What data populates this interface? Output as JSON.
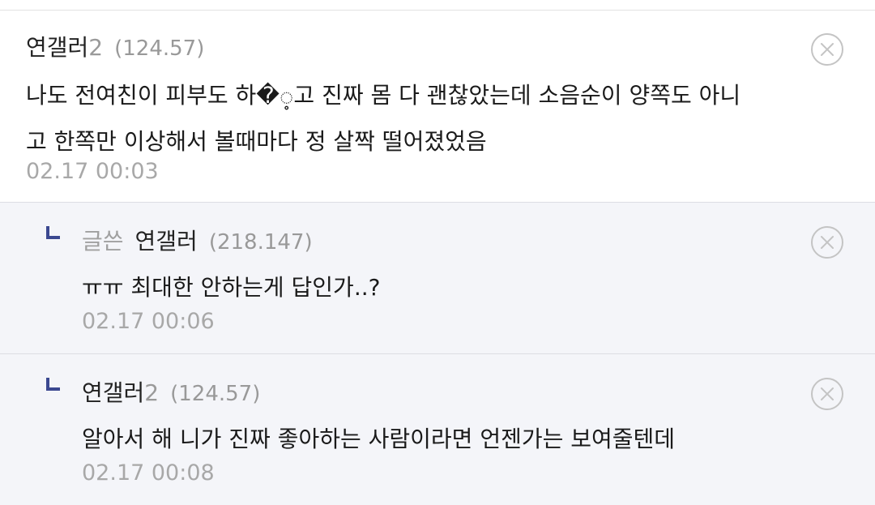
{
  "comments": [
    {
      "nickname": "연갤러",
      "nickname_suffix": "2",
      "ip": "(124.57)",
      "lines": [
        "나도 전여친이 피부도 하�့고 진짜 몸 다 괜찮았는데 소음순이 양쪽도 아니",
        "고 한쪽만 이상해서 볼때마다 정 살짝 떨어졌었음"
      ],
      "time": "02.17 00:03"
    }
  ],
  "replies": [
    {
      "author_tag": "글쓴",
      "nickname": "연갤러",
      "nickname_suffix": "",
      "ip": "(218.147)",
      "text": "ㅠㅠ 최대한 안하는게 답인가..?",
      "time": "02.17 00:06"
    },
    {
      "author_tag": "",
      "nickname": "연갤러",
      "nickname_suffix": "2",
      "ip": "(124.57)",
      "text": "알아서 해 니가 진짜 좋아하는 사람이라면 언젠가는 보여줄텐데",
      "time": "02.17 00:08"
    }
  ],
  "icons": {
    "delete": "close-circle-icon",
    "reply": "reply-arrow-icon"
  },
  "colors": {
    "reply_background": "#f4f5f9",
    "reply_arrow": "#3b4890",
    "meta_gray": "#a8a8a8"
  }
}
